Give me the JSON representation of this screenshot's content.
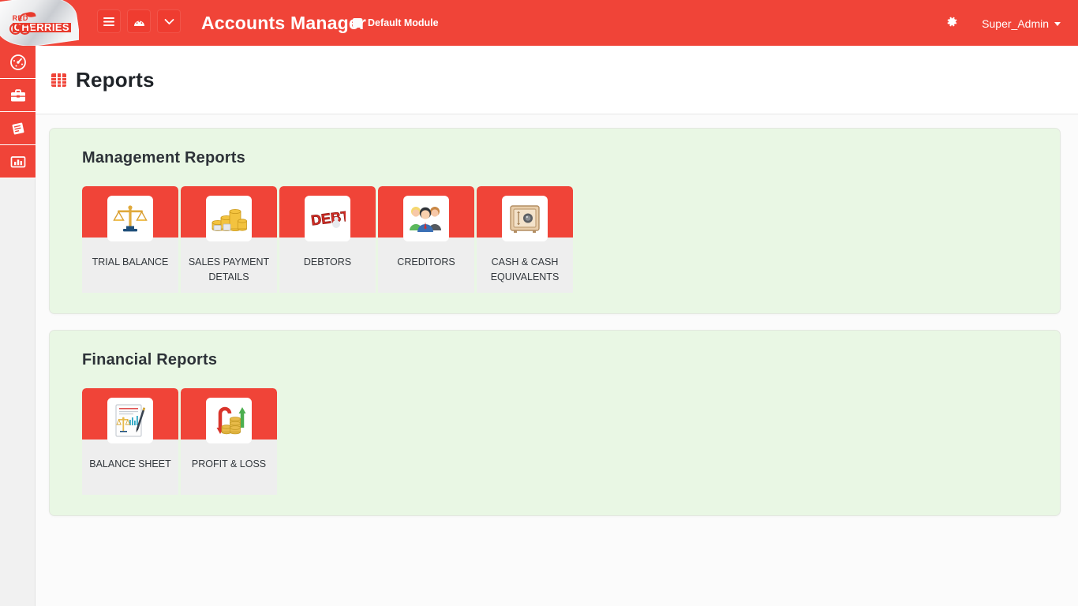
{
  "brand": {
    "logo_line1": "RED",
    "logo_line2": "CHERRIES",
    "accent_red": "#f04438",
    "logo_red": "#e8392c",
    "section_green": "#e9f7e4",
    "card_body_gray": "#eeeeee"
  },
  "header": {
    "title": "Accounts Manager",
    "module_label": "Default Module",
    "user": "Super_Admin",
    "buttons": [
      {
        "name": "menu-toggle-button",
        "icon": "hamburger-icon",
        "glyph": "☰"
      },
      {
        "name": "dashboard-button",
        "icon": "speedometer-icon",
        "glyph": "◔"
      },
      {
        "name": "more-button",
        "icon": "chevron-down-icon",
        "glyph": "ˇ"
      }
    ],
    "settings_icon": "gear-icon",
    "settings_glyph": "⚙"
  },
  "sidebar": {
    "items": [
      {
        "label": "Dashboard",
        "icon": "speedometer-icon"
      },
      {
        "label": "Briefcase",
        "icon": "briefcase-icon"
      },
      {
        "label": "Ledger",
        "icon": "book-icon"
      },
      {
        "label": "Reports",
        "icon": "bar-chart-icon",
        "active": true
      }
    ]
  },
  "page": {
    "title": "Reports",
    "title_icon": "table-grid-icon"
  },
  "sections": [
    {
      "title": "Management Reports",
      "cards": [
        {
          "label": "TRIAL BALANCE",
          "icon": "balance-scale-icon"
        },
        {
          "label": "SALES PAYMENT DETAILS",
          "icon": "coins-stack-icon"
        },
        {
          "label": "DEBTORS",
          "icon": "debt-text-icon"
        },
        {
          "label": "CREDITORS",
          "icon": "people-group-icon"
        },
        {
          "label": "CASH & CASH EQUIVALENTS",
          "icon": "safe-vault-icon"
        }
      ]
    },
    {
      "title": "Financial Reports",
      "cards": [
        {
          "label": "BALANCE SHEET",
          "icon": "balance-sheet-document-icon"
        },
        {
          "label": "PROFIT & LOSS",
          "icon": "profit-loss-arrows-icon"
        }
      ]
    }
  ]
}
